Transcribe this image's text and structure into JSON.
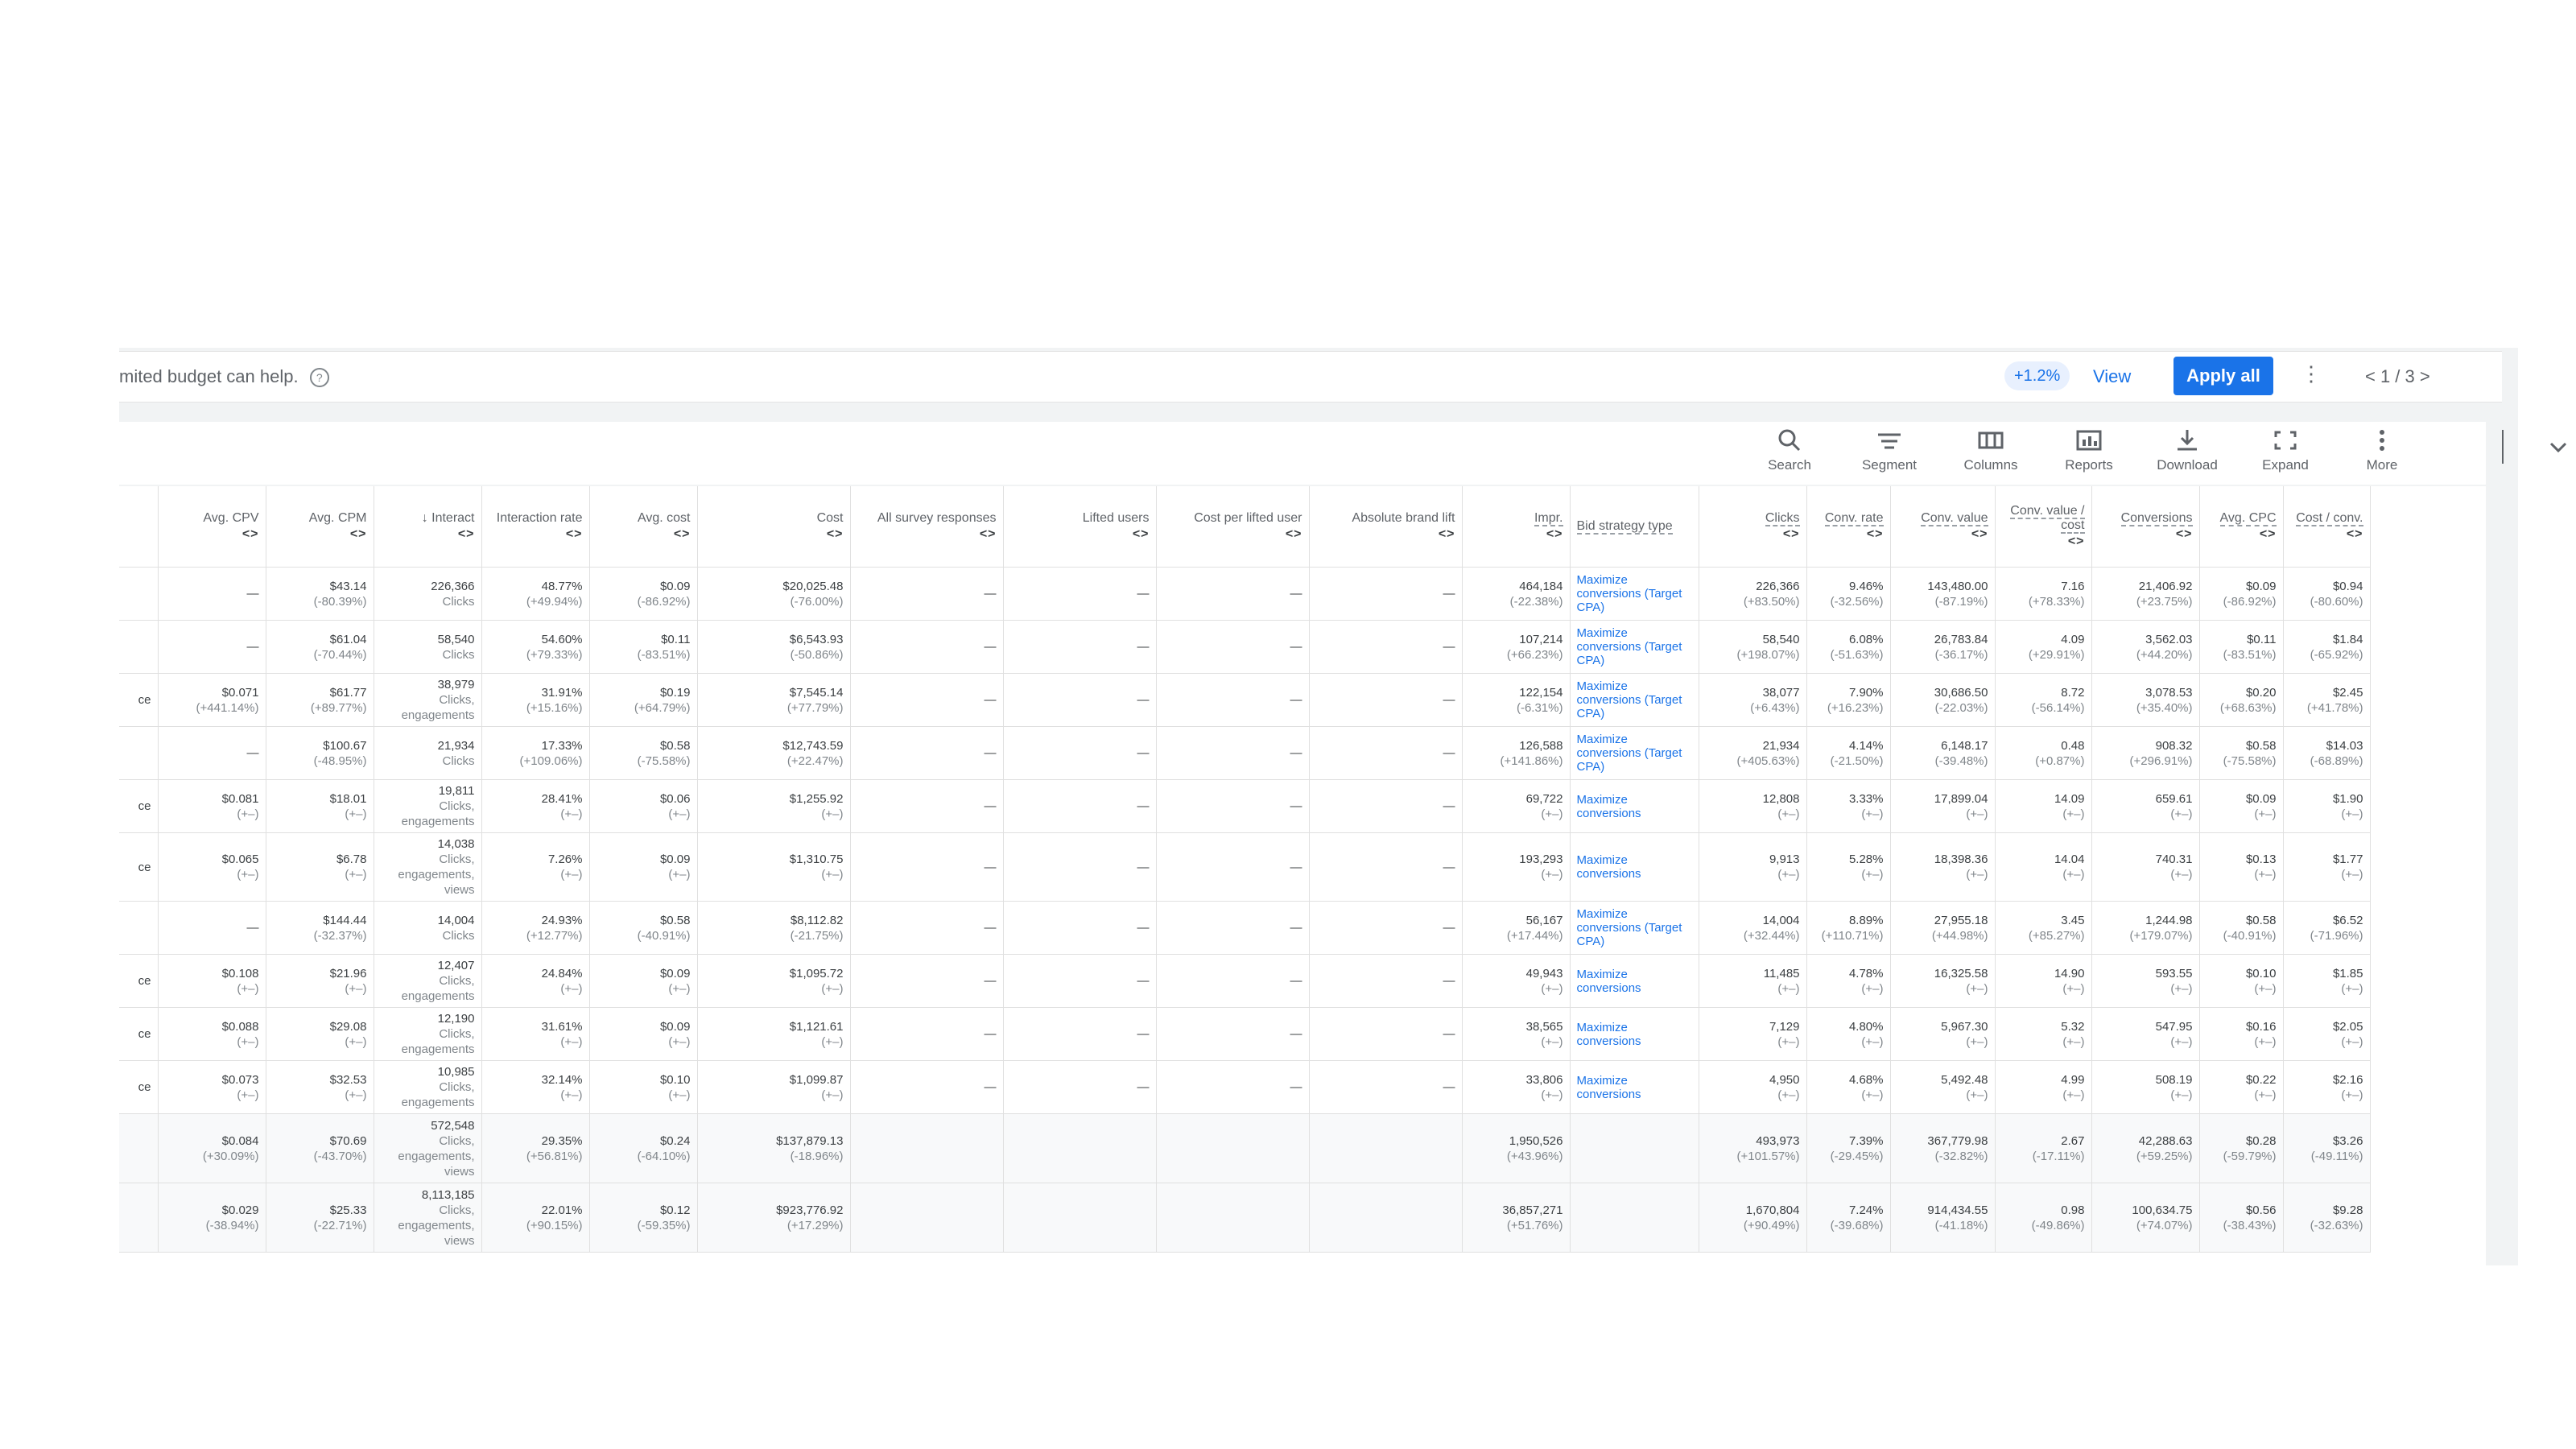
{
  "banner": {
    "message": "mited budget can help.",
    "change_pill": "+1.2%",
    "view_label": "View",
    "apply_all_label": "Apply all",
    "pager": "< 1 / 3 >"
  },
  "toolbar": {
    "items": [
      {
        "label": "Search",
        "icon": "search-icon"
      },
      {
        "label": "Segment",
        "icon": "segment-icon"
      },
      {
        "label": "Columns",
        "icon": "columns-icon"
      },
      {
        "label": "Reports",
        "icon": "reports-icon"
      },
      {
        "label": "Download",
        "icon": "download-icon"
      },
      {
        "label": "Expand",
        "icon": "expand-icon"
      },
      {
        "label": "More",
        "icon": "more-icon"
      }
    ]
  },
  "table": {
    "columns": [
      {
        "label": "",
        "arrows": ""
      },
      {
        "label": "Avg. CPV",
        "arrows": "<>"
      },
      {
        "label": "Avg. CPM",
        "arrows": "<>"
      },
      {
        "label": "↓ Interact",
        "arrows": "<>"
      },
      {
        "label": "Interaction rate",
        "arrows": "<>"
      },
      {
        "label": "Avg. cost",
        "arrows": "<>"
      },
      {
        "label": "Cost",
        "arrows": "<>"
      },
      {
        "label": "All survey responses",
        "arrows": "<>"
      },
      {
        "label": "Lifted users",
        "arrows": "<>"
      },
      {
        "label": "Cost per lifted user",
        "arrows": "<>"
      },
      {
        "label": "Absolute brand lift",
        "arrows": "<>"
      },
      {
        "label": "Impr.",
        "arrows": "<>"
      },
      {
        "label": "Bid strategy type",
        "arrows": ""
      },
      {
        "label": "Clicks",
        "arrows": "<>"
      },
      {
        "label": "Conv. rate",
        "arrows": "<>"
      },
      {
        "label": "Conv. value",
        "arrows": "<>"
      },
      {
        "label": "Conv. value / cost",
        "arrows": "<>"
      },
      {
        "label": "Conversions",
        "arrows": "<>"
      },
      {
        "label": "Avg. CPC",
        "arrows": "<>"
      },
      {
        "label": "Cost / conv.",
        "arrows": "<>"
      }
    ],
    "rows": [
      [
        [
          "",
          ""
        ],
        [
          "—",
          ""
        ],
        [
          "$43.14",
          "(-80.39%)"
        ],
        [
          "226,366",
          "Clicks"
        ],
        [
          "48.77%",
          "(+49.94%)"
        ],
        [
          "$0.09",
          "(-86.92%)"
        ],
        [
          "$20,025.48",
          "(-76.00%)"
        ],
        [
          "—",
          ""
        ],
        [
          "—",
          ""
        ],
        [
          "—",
          ""
        ],
        [
          "—",
          ""
        ],
        [
          "464,184",
          "(-22.38%)"
        ],
        [
          "Maximize conversions (Target CPA)",
          ""
        ],
        [
          "226,366",
          "(+83.50%)"
        ],
        [
          "9.46%",
          "(-32.56%)"
        ],
        [
          "143,480.00",
          "(-87.19%)"
        ],
        [
          "7.16",
          "(+78.33%)"
        ],
        [
          "21,406.92",
          "(+23.75%)"
        ],
        [
          "$0.09",
          "(-86.92%)"
        ],
        [
          "$0.94",
          "(-80.60%)"
        ]
      ],
      [
        [
          "",
          ""
        ],
        [
          "—",
          ""
        ],
        [
          "$61.04",
          "(-70.44%)"
        ],
        [
          "58,540",
          "Clicks"
        ],
        [
          "54.60%",
          "(+79.33%)"
        ],
        [
          "$0.11",
          "(-83.51%)"
        ],
        [
          "$6,543.93",
          "(-50.86%)"
        ],
        [
          "—",
          ""
        ],
        [
          "—",
          ""
        ],
        [
          "—",
          ""
        ],
        [
          "—",
          ""
        ],
        [
          "107,214",
          "(+66.23%)"
        ],
        [
          "Maximize conversions (Target CPA)",
          ""
        ],
        [
          "58,540",
          "(+198.07%)"
        ],
        [
          "6.08%",
          "(-51.63%)"
        ],
        [
          "26,783.84",
          "(-36.17%)"
        ],
        [
          "4.09",
          "(+29.91%)"
        ],
        [
          "3,562.03",
          "(+44.20%)"
        ],
        [
          "$0.11",
          "(-83.51%)"
        ],
        [
          "$1.84",
          "(-65.92%)"
        ]
      ],
      [
        [
          "ce",
          ""
        ],
        [
          "$0.071",
          "(+441.14%)"
        ],
        [
          "$61.77",
          "(+89.77%)"
        ],
        [
          "38,979",
          "Clicks, engagements"
        ],
        [
          "31.91%",
          "(+15.16%)"
        ],
        [
          "$0.19",
          "(+64.79%)"
        ],
        [
          "$7,545.14",
          "(+77.79%)"
        ],
        [
          "—",
          ""
        ],
        [
          "—",
          ""
        ],
        [
          "—",
          ""
        ],
        [
          "—",
          ""
        ],
        [
          "122,154",
          "(-6.31%)"
        ],
        [
          "Maximize conversions (Target CPA)",
          ""
        ],
        [
          "38,077",
          "(+6.43%)"
        ],
        [
          "7.90%",
          "(+16.23%)"
        ],
        [
          "30,686.50",
          "(-22.03%)"
        ],
        [
          "8.72",
          "(-56.14%)"
        ],
        [
          "3,078.53",
          "(+35.40%)"
        ],
        [
          "$0.20",
          "(+68.63%)"
        ],
        [
          "$2.45",
          "(+41.78%)"
        ]
      ],
      [
        [
          "",
          ""
        ],
        [
          "—",
          ""
        ],
        [
          "$100.67",
          "(-48.95%)"
        ],
        [
          "21,934",
          "Clicks"
        ],
        [
          "17.33%",
          "(+109.06%)"
        ],
        [
          "$0.58",
          "(-75.58%)"
        ],
        [
          "$12,743.59",
          "(+22.47%)"
        ],
        [
          "—",
          ""
        ],
        [
          "—",
          ""
        ],
        [
          "—",
          ""
        ],
        [
          "—",
          ""
        ],
        [
          "126,588",
          "(+141.86%)"
        ],
        [
          "Maximize conversions (Target CPA)",
          ""
        ],
        [
          "21,934",
          "(+405.63%)"
        ],
        [
          "4.14%",
          "(-21.50%)"
        ],
        [
          "6,148.17",
          "(-39.48%)"
        ],
        [
          "0.48",
          "(+0.87%)"
        ],
        [
          "908.32",
          "(+296.91%)"
        ],
        [
          "$0.58",
          "(-75.58%)"
        ],
        [
          "$14.03",
          "(-68.89%)"
        ]
      ],
      [
        [
          "ce",
          ""
        ],
        [
          "$0.081",
          "(+–)"
        ],
        [
          "$18.01",
          "(+–)"
        ],
        [
          "19,811",
          "Clicks, engagements"
        ],
        [
          "28.41%",
          "(+–)"
        ],
        [
          "$0.06",
          "(+–)"
        ],
        [
          "$1,255.92",
          "(+–)"
        ],
        [
          "—",
          ""
        ],
        [
          "—",
          ""
        ],
        [
          "—",
          ""
        ],
        [
          "—",
          ""
        ],
        [
          "69,722",
          "(+–)"
        ],
        [
          "Maximize conversions",
          ""
        ],
        [
          "12,808",
          "(+–)"
        ],
        [
          "3.33%",
          "(+–)"
        ],
        [
          "17,899.04",
          "(+–)"
        ],
        [
          "14.09",
          "(+–)"
        ],
        [
          "659.61",
          "(+–)"
        ],
        [
          "$0.09",
          "(+–)"
        ],
        [
          "$1.90",
          "(+–)"
        ]
      ],
      [
        [
          "ce",
          ""
        ],
        [
          "$0.065",
          "(+–)"
        ],
        [
          "$6.78",
          "(+–)"
        ],
        [
          "14,038",
          "Clicks, engagements, views"
        ],
        [
          "7.26%",
          "(+–)"
        ],
        [
          "$0.09",
          "(+–)"
        ],
        [
          "$1,310.75",
          "(+–)"
        ],
        [
          "—",
          ""
        ],
        [
          "—",
          ""
        ],
        [
          "—",
          ""
        ],
        [
          "—",
          ""
        ],
        [
          "193,293",
          "(+–)"
        ],
        [
          "Maximize conversions",
          ""
        ],
        [
          "9,913",
          "(+–)"
        ],
        [
          "5.28%",
          "(+–)"
        ],
        [
          "18,398.36",
          "(+–)"
        ],
        [
          "14.04",
          "(+–)"
        ],
        [
          "740.31",
          "(+–)"
        ],
        [
          "$0.13",
          "(+–)"
        ],
        [
          "$1.77",
          "(+–)"
        ]
      ],
      [
        [
          "",
          ""
        ],
        [
          "—",
          ""
        ],
        [
          "$144.44",
          "(-32.37%)"
        ],
        [
          "14,004",
          "Clicks"
        ],
        [
          "24.93%",
          "(+12.77%)"
        ],
        [
          "$0.58",
          "(-40.91%)"
        ],
        [
          "$8,112.82",
          "(-21.75%)"
        ],
        [
          "—",
          ""
        ],
        [
          "—",
          ""
        ],
        [
          "—",
          ""
        ],
        [
          "—",
          ""
        ],
        [
          "56,167",
          "(+17.44%)"
        ],
        [
          "Maximize conversions (Target CPA)",
          ""
        ],
        [
          "14,004",
          "(+32.44%)"
        ],
        [
          "8.89%",
          "(+110.71%)"
        ],
        [
          "27,955.18",
          "(+44.98%)"
        ],
        [
          "3.45",
          "(+85.27%)"
        ],
        [
          "1,244.98",
          "(+179.07%)"
        ],
        [
          "$0.58",
          "(-40.91%)"
        ],
        [
          "$6.52",
          "(-71.96%)"
        ]
      ],
      [
        [
          "ce",
          ""
        ],
        [
          "$0.108",
          "(+–)"
        ],
        [
          "$21.96",
          "(+–)"
        ],
        [
          "12,407",
          "Clicks, engagements"
        ],
        [
          "24.84%",
          "(+–)"
        ],
        [
          "$0.09",
          "(+–)"
        ],
        [
          "$1,095.72",
          "(+–)"
        ],
        [
          "—",
          ""
        ],
        [
          "—",
          ""
        ],
        [
          "—",
          ""
        ],
        [
          "—",
          ""
        ],
        [
          "49,943",
          "(+–)"
        ],
        [
          "Maximize conversions",
          ""
        ],
        [
          "11,485",
          "(+–)"
        ],
        [
          "4.78%",
          "(+–)"
        ],
        [
          "16,325.58",
          "(+–)"
        ],
        [
          "14.90",
          "(+–)"
        ],
        [
          "593.55",
          "(+–)"
        ],
        [
          "$0.10",
          "(+–)"
        ],
        [
          "$1.85",
          "(+–)"
        ]
      ],
      [
        [
          "ce",
          ""
        ],
        [
          "$0.088",
          "(+–)"
        ],
        [
          "$29.08",
          "(+–)"
        ],
        [
          "12,190",
          "Clicks, engagements"
        ],
        [
          "31.61%",
          "(+–)"
        ],
        [
          "$0.09",
          "(+–)"
        ],
        [
          "$1,121.61",
          "(+–)"
        ],
        [
          "—",
          ""
        ],
        [
          "—",
          ""
        ],
        [
          "—",
          ""
        ],
        [
          "—",
          ""
        ],
        [
          "38,565",
          "(+–)"
        ],
        [
          "Maximize conversions",
          ""
        ],
        [
          "7,129",
          "(+–)"
        ],
        [
          "4.80%",
          "(+–)"
        ],
        [
          "5,967.30",
          "(+–)"
        ],
        [
          "5.32",
          "(+–)"
        ],
        [
          "547.95",
          "(+–)"
        ],
        [
          "$0.16",
          "(+–)"
        ],
        [
          "$2.05",
          "(+–)"
        ]
      ],
      [
        [
          "ce",
          ""
        ],
        [
          "$0.073",
          "(+–)"
        ],
        [
          "$32.53",
          "(+–)"
        ],
        [
          "10,985",
          "Clicks, engagements"
        ],
        [
          "32.14%",
          "(+–)"
        ],
        [
          "$0.10",
          "(+–)"
        ],
        [
          "$1,099.87",
          "(+–)"
        ],
        [
          "—",
          ""
        ],
        [
          "—",
          ""
        ],
        [
          "—",
          ""
        ],
        [
          "—",
          ""
        ],
        [
          "33,806",
          "(+–)"
        ],
        [
          "Maximize conversions",
          ""
        ],
        [
          "4,950",
          "(+–)"
        ],
        [
          "4.68%",
          "(+–)"
        ],
        [
          "5,492.48",
          "(+–)"
        ],
        [
          "4.99",
          "(+–)"
        ],
        [
          "508.19",
          "(+–)"
        ],
        [
          "$0.22",
          "(+–)"
        ],
        [
          "$2.16",
          "(+–)"
        ]
      ]
    ],
    "totals": [
      [
        [
          "",
          ""
        ],
        [
          "$0.084",
          "(+30.09%)"
        ],
        [
          "$70.69",
          "(-43.70%)"
        ],
        [
          "572,548",
          "Clicks, engagements, views"
        ],
        [
          "29.35%",
          "(+56.81%)"
        ],
        [
          "$0.24",
          "(-64.10%)"
        ],
        [
          "$137,879.13",
          "(-18.96%)"
        ],
        [
          "",
          ""
        ],
        [
          "",
          ""
        ],
        [
          "",
          ""
        ],
        [
          "",
          ""
        ],
        [
          "1,950,526",
          "(+43.96%)"
        ],
        [
          "",
          ""
        ],
        [
          "493,973",
          "(+101.57%)"
        ],
        [
          "7.39%",
          "(-29.45%)"
        ],
        [
          "367,779.98",
          "(-32.82%)"
        ],
        [
          "2.67",
          "(-17.11%)"
        ],
        [
          "42,288.63",
          "(+59.25%)"
        ],
        [
          "$0.28",
          "(-59.79%)"
        ],
        [
          "$3.26",
          "(-49.11%)"
        ]
      ],
      [
        [
          "",
          ""
        ],
        [
          "$0.029",
          "(-38.94%)"
        ],
        [
          "$25.33",
          "(-22.71%)"
        ],
        [
          "8,113,185",
          "Clicks, engagements, views"
        ],
        [
          "22.01%",
          "(+90.15%)"
        ],
        [
          "$0.12",
          "(-59.35%)"
        ],
        [
          "$923,776.92",
          "(+17.29%)"
        ],
        [
          "",
          ""
        ],
        [
          "",
          ""
        ],
        [
          "",
          ""
        ],
        [
          "",
          ""
        ],
        [
          "36,857,271",
          "(+51.76%)"
        ],
        [
          "",
          ""
        ],
        [
          "1,670,804",
          "(+90.49%)"
        ],
        [
          "7.24%",
          "(-39.68%)"
        ],
        [
          "914,434.55",
          "(-41.18%)"
        ],
        [
          "0.98",
          "(-49.86%)"
        ],
        [
          "100,634.75",
          "(+74.07%)"
        ],
        [
          "$0.56",
          "(-38.43%)"
        ],
        [
          "$9.28",
          "(-32.63%)"
        ]
      ]
    ]
  }
}
